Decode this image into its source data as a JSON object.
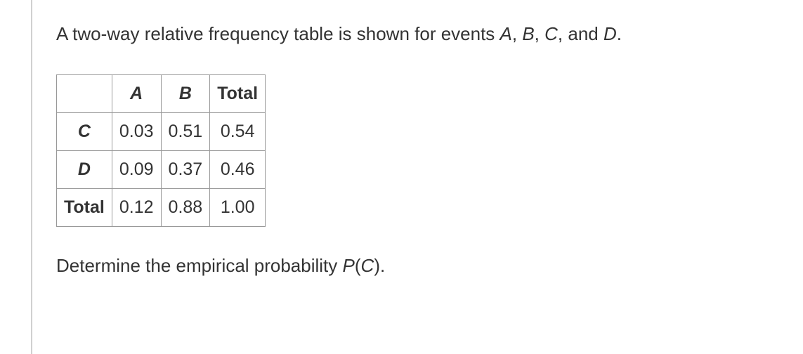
{
  "intro": {
    "prefix": "A two-way relative frequency table is shown for events ",
    "A": "A",
    "sep1": ", ",
    "B": "B",
    "sep2": ", ",
    "C": "C",
    "sep3": ", and ",
    "D": "D",
    "suffix": "."
  },
  "table": {
    "headers": {
      "blank": "",
      "A": "A",
      "B": "B",
      "Total": "Total"
    },
    "rows": {
      "C": {
        "label": "C",
        "A": "0.03",
        "B": "0.51",
        "Total": "0.54"
      },
      "D": {
        "label": "D",
        "A": "0.09",
        "B": "0.37",
        "Total": "0.46"
      },
      "Total": {
        "label": "Total",
        "A": "0.12",
        "B": "0.88",
        "Total": "1.00"
      }
    }
  },
  "question": {
    "prefix": "Determine the empirical probability ",
    "P": "P",
    "open": "(",
    "C": "C",
    "close": ")."
  }
}
